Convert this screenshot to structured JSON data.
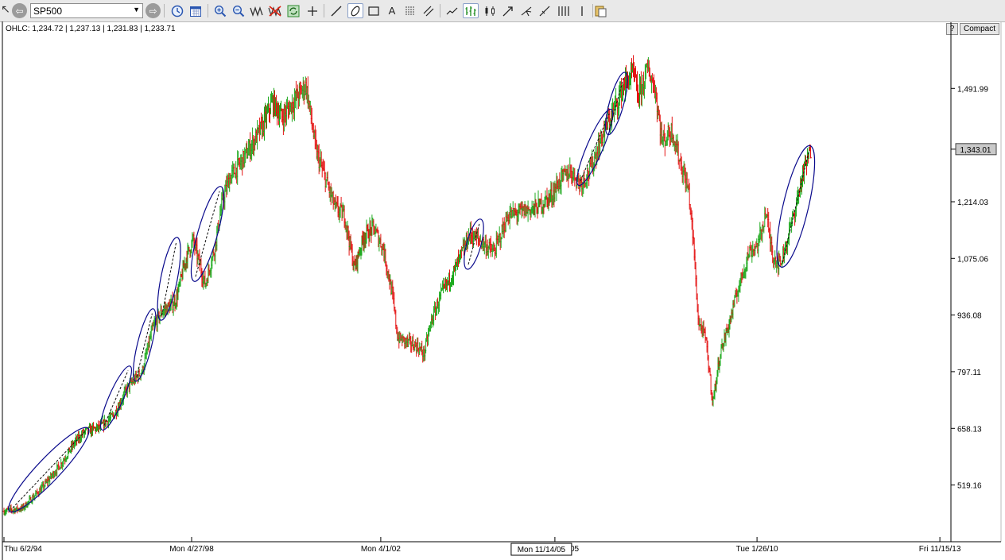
{
  "toolbar": {
    "symbol": "SP500",
    "back_icon": "arrow-left-icon",
    "forward_icon": "arrow-right-icon",
    "tools": [
      "clock-icon",
      "calendar-icon",
      "zoom-in-icon",
      "zoom-out-icon",
      "wave-icon",
      "delete-drawing-icon",
      "refresh-icon",
      "crosshair-icon",
      "line-tool-icon",
      "ellipse-tool-icon",
      "rectangle-tool-icon",
      "text-tool-icon",
      "fibonacci-icon",
      "parallel-lines-icon",
      "line-chart-icon",
      "bar-chart-icon",
      "candlestick-icon",
      "arrow-tool-icon",
      "pitchfork-icon",
      "trendline-icon",
      "cycle-lines-icon",
      "vertical-line-icon",
      "clipboard-icon"
    ]
  },
  "header": {
    "ohlc_text": "OHLC: 1,234.72 | 1,237.13 | 1,231.83 | 1,233.71",
    "help_label": "?",
    "compact_label": "Compact"
  },
  "chart_data": {
    "type": "ohlc",
    "series_name": "SP500",
    "colors": {
      "up": "#1faa1f",
      "down": "#e41414",
      "ellipse": "#0a0a8c",
      "axis": "#000000"
    },
    "ylim": [
      380,
      1631
    ],
    "y_ticks": [
      "1,491.99",
      "1,214.03",
      "1,075.06",
      "936.08",
      "797.11",
      "658.13",
      "519.16"
    ],
    "y_tick_values": [
      1491.99,
      1214.03,
      1075.06,
      936.08,
      797.11,
      658.13,
      519.16
    ],
    "current_value_label": "1,343.01",
    "current_value": 1343.01,
    "x_ticks": [
      "Thu 6/2/94",
      "Mon 4/27/98",
      "Mon 4/1/02",
      "Mon 11/14/05",
      "Tue 1/26/10",
      "Fri 11/15/13"
    ],
    "x_tick_years": [
      1994.42,
      1998.32,
      2002.25,
      2005.87,
      2010.07,
      2013.87
    ],
    "x_range": [
      1994.42,
      2014.1
    ],
    "crosshair_label": "Mon 11/14/05",
    "price_path": [
      [
        1994.42,
        455
      ],
      [
        1994.8,
        462
      ],
      [
        1995.2,
        510
      ],
      [
        1995.6,
        570
      ],
      [
        1995.9,
        625
      ],
      [
        1996.1,
        650
      ],
      [
        1996.4,
        660
      ],
      [
        1996.7,
        690
      ],
      [
        1997.0,
        760
      ],
      [
        1997.3,
        800
      ],
      [
        1997.5,
        900
      ],
      [
        1997.7,
        945
      ],
      [
        1997.9,
        960
      ],
      [
        1998.0,
        975
      ],
      [
        1998.2,
        1075
      ],
      [
        1998.35,
        1120
      ],
      [
        1998.6,
        1010
      ],
      [
        1998.8,
        1100
      ],
      [
        1998.95,
        1210
      ],
      [
        1999.1,
        1270
      ],
      [
        1999.4,
        1320
      ],
      [
        1999.6,
        1360
      ],
      [
        1999.8,
        1400
      ],
      [
        2000.0,
        1460
      ],
      [
        2000.2,
        1420
      ],
      [
        2000.5,
        1470
      ],
      [
        2000.7,
        1500
      ],
      [
        2000.9,
        1340
      ],
      [
        2001.1,
        1270
      ],
      [
        2001.3,
        1200
      ],
      [
        2001.5,
        1180
      ],
      [
        2001.7,
        1050
      ],
      [
        2001.9,
        1130
      ],
      [
        2002.1,
        1150
      ],
      [
        2002.3,
        1100
      ],
      [
        2002.5,
        980
      ],
      [
        2002.6,
        880
      ],
      [
        2002.8,
        870
      ],
      [
        2003.0,
        860
      ],
      [
        2003.15,
        840
      ],
      [
        2003.3,
        920
      ],
      [
        2003.5,
        985
      ],
      [
        2003.8,
        1050
      ],
      [
        2004.1,
        1135
      ],
      [
        2004.3,
        1120
      ],
      [
        2004.6,
        1090
      ],
      [
        2004.9,
        1180
      ],
      [
        2005.2,
        1190
      ],
      [
        2005.5,
        1200
      ],
      [
        2005.8,
        1230
      ],
      [
        2006.0,
        1270
      ],
      [
        2006.2,
        1290
      ],
      [
        2006.4,
        1260
      ],
      [
        2006.6,
        1290
      ],
      [
        2006.9,
        1390
      ],
      [
        2007.1,
        1440
      ],
      [
        2007.3,
        1500
      ],
      [
        2007.5,
        1530
      ],
      [
        2007.6,
        1470
      ],
      [
        2007.8,
        1540
      ],
      [
        2007.95,
        1490
      ],
      [
        2008.1,
        1360
      ],
      [
        2008.3,
        1390
      ],
      [
        2008.5,
        1300
      ],
      [
        2008.65,
        1240
      ],
      [
        2008.75,
        1110
      ],
      [
        2008.85,
        920
      ],
      [
        2009.0,
        880
      ],
      [
        2009.15,
        720
      ],
      [
        2009.3,
        840
      ],
      [
        2009.5,
        920
      ],
      [
        2009.7,
        1010
      ],
      [
        2009.9,
        1090
      ],
      [
        2010.1,
        1110
      ],
      [
        2010.25,
        1190
      ],
      [
        2010.4,
        1080
      ],
      [
        2010.55,
        1060
      ],
      [
        2010.7,
        1120
      ],
      [
        2010.85,
        1190
      ],
      [
        2011.0,
        1270
      ],
      [
        2011.1,
        1310
      ],
      [
        2011.2,
        1343
      ]
    ],
    "ellipses": [
      {
        "x1": 1994.6,
        "y1": 463,
        "x2": 1996.1,
        "y2": 650
      },
      {
        "x1": 1996.5,
        "y1": 665,
        "x2": 1997.0,
        "y2": 800
      },
      {
        "x1": 1997.18,
        "y1": 785,
        "x2": 1997.5,
        "y2": 940
      },
      {
        "x1": 1997.7,
        "y1": 935,
        "x2": 1998.0,
        "y2": 1115
      },
      {
        "x1": 1998.4,
        "y1": 1030,
        "x2": 1998.9,
        "y2": 1240
      },
      {
        "x1": 2004.07,
        "y1": 1060,
        "x2": 2004.3,
        "y2": 1160
      },
      {
        "x1": 2006.4,
        "y1": 1265,
        "x2": 2007.0,
        "y2": 1430
      },
      {
        "x1": 2007.0,
        "y1": 1390,
        "x2": 2007.3,
        "y2": 1520
      },
      {
        "x1": 2010.6,
        "y1": 1065,
        "x2": 2011.15,
        "y2": 1340
      }
    ]
  }
}
